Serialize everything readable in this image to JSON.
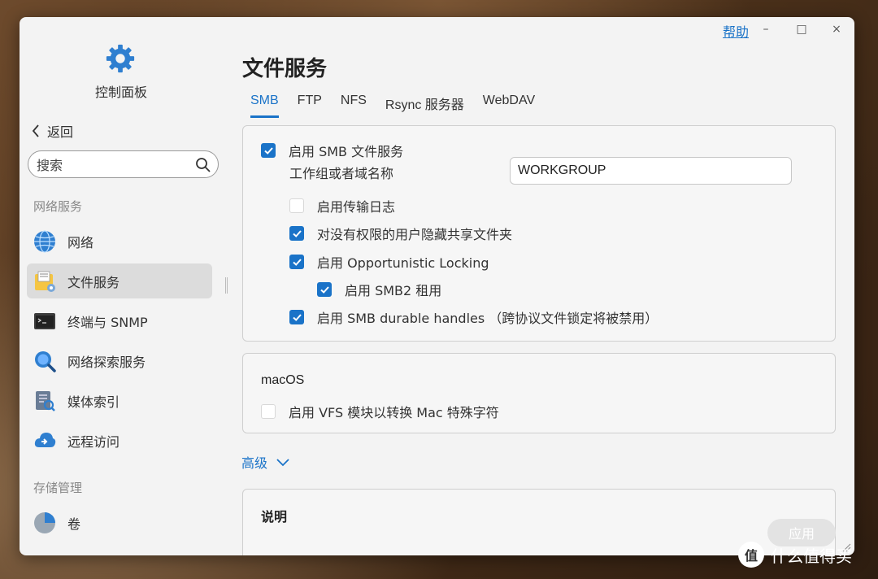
{
  "app": {
    "title": "控制面板"
  },
  "sidebar": {
    "back_label": "返回",
    "search_placeholder": "搜索",
    "sections": [
      {
        "label": "网络服务"
      },
      {
        "label": "存储管理"
      }
    ],
    "items": [
      {
        "label": "网络",
        "icon": "globe-icon"
      },
      {
        "label": "文件服务",
        "icon": "file-services-icon",
        "active": true
      },
      {
        "label": "终端与 SNMP",
        "icon": "terminal-icon"
      },
      {
        "label": "网络探索服务",
        "icon": "network-discovery-icon"
      },
      {
        "label": "媒体索引",
        "icon": "media-index-icon"
      },
      {
        "label": "远程访问",
        "icon": "remote-access-icon"
      },
      {
        "label": "卷",
        "icon": "volume-icon"
      }
    ]
  },
  "titlebar": {
    "help_label": "帮助",
    "minimize": "–",
    "maximize": "□",
    "close": "×"
  },
  "main": {
    "title": "文件服务",
    "tabs": [
      {
        "label": "SMB",
        "active": true
      },
      {
        "label": "FTP"
      },
      {
        "label": "NFS"
      },
      {
        "label": "Rsync 服务器"
      },
      {
        "label": "WebDAV"
      }
    ],
    "smb_panel": {
      "enable_smb": {
        "label": "启用 SMB 文件服务",
        "checked": true
      },
      "workgroup_label": "工作组或者域名称",
      "workgroup_value": "WORKGROUP",
      "options": [
        {
          "label": "启用传输日志",
          "checked": false
        },
        {
          "label": "对没有权限的用户隐藏共享文件夹",
          "checked": true
        },
        {
          "label": "启用 Opportunistic Locking",
          "checked": true
        },
        {
          "label": "启用 SMB2 租用",
          "checked": true
        },
        {
          "label": "启用 SMB durable handles （跨协议文件锁定将被禁用）",
          "checked": true
        }
      ]
    },
    "macos_panel": {
      "title": "macOS",
      "vfs": {
        "label": "启用 VFS 模块以转换 Mac 特殊字符",
        "checked": false
      }
    },
    "advanced_label": "高级",
    "notes_title": "说明",
    "apply_label": "应用"
  },
  "watermark": {
    "logo_text": "值",
    "text": "什么值得买"
  },
  "colors": {
    "accent": "#1a73c8",
    "window_bg": "#f3f3f3"
  }
}
